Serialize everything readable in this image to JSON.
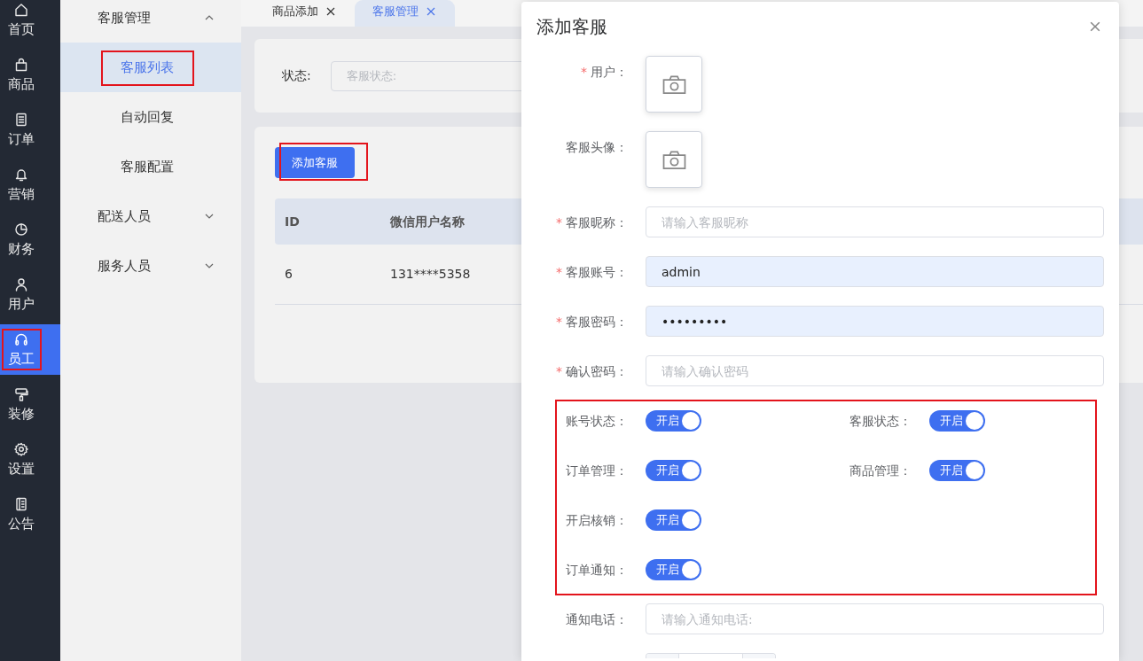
{
  "rail": {
    "items": [
      {
        "label": "首页",
        "selected": false,
        "highlighted": false
      },
      {
        "label": "商品",
        "selected": false,
        "highlighted": false
      },
      {
        "label": "订单",
        "selected": false,
        "highlighted": false
      },
      {
        "label": "营销",
        "selected": false,
        "highlighted": false
      },
      {
        "label": "财务",
        "selected": false,
        "highlighted": false
      },
      {
        "label": "用户",
        "selected": false,
        "highlighted": false
      },
      {
        "label": "员工",
        "selected": true,
        "highlighted": true
      },
      {
        "label": "装修",
        "selected": false,
        "highlighted": false
      },
      {
        "label": "设置",
        "selected": false,
        "highlighted": false
      },
      {
        "label": "公告",
        "selected": false,
        "highlighted": false
      }
    ]
  },
  "submenu": {
    "groups": [
      {
        "label": "客服管理",
        "expanded": true,
        "children": [
          {
            "label": "客服列表",
            "selected": true,
            "highlighted": true
          },
          {
            "label": "自动回复",
            "selected": false,
            "highlighted": false
          },
          {
            "label": "客服配置",
            "selected": false,
            "highlighted": false
          }
        ]
      },
      {
        "label": "配送人员",
        "expanded": false
      },
      {
        "label": "服务人员",
        "expanded": false
      }
    ]
  },
  "tabs": [
    {
      "label": "商品添加",
      "selected": false
    },
    {
      "label": "客服管理",
      "selected": true
    }
  ],
  "filter": {
    "label": "状态:",
    "placeholder": "客服状态:"
  },
  "add_button": {
    "label": "添加客服",
    "highlighted": true
  },
  "table": {
    "columns": [
      "ID",
      "微信用户名称"
    ],
    "rows": [
      [
        "6",
        "131****5358"
      ]
    ]
  },
  "dialog": {
    "title": "添加客服",
    "fields": [
      {
        "kind": "upload",
        "label": "用户：",
        "required_mark": "*"
      },
      {
        "kind": "upload",
        "label": "客服头像："
      },
      {
        "kind": "input",
        "label": "客服昵称：",
        "required_mark": "*",
        "placeholder": "请输入客服昵称",
        "autofilled": false
      },
      {
        "kind": "input",
        "label": "客服账号：",
        "required_mark": "*",
        "value": "admin",
        "autofilled": true
      },
      {
        "kind": "input",
        "label": "客服密码：",
        "required_mark": "*",
        "value": "•••••••••",
        "autofilled": true
      },
      {
        "kind": "input",
        "label": "确认密码：",
        "required_mark": "*",
        "placeholder": "请输入确认密码",
        "autofilled": false
      },
      {
        "kind": "switch_group",
        "highlighted": true,
        "rows": [
          [
            {
              "label": "账号状态：",
              "text": "开启",
              "on": true
            },
            {
              "label": "客服状态：",
              "text": "开启",
              "on": true
            }
          ],
          [
            {
              "label": "订单管理：",
              "text": "开启",
              "on": true
            },
            {
              "label": "商品管理：",
              "text": "开启",
              "on": true
            }
          ],
          [
            {
              "label": "开启核销：",
              "text": "开启",
              "on": true
            }
          ],
          [
            {
              "label": "订单通知：",
              "text": "开启",
              "on": true
            }
          ]
        ]
      },
      {
        "kind": "input",
        "label": "通知电话：",
        "placeholder": "请输入通知电话:",
        "autofilled": false
      },
      {
        "kind": "stepper"
      }
    ]
  }
}
